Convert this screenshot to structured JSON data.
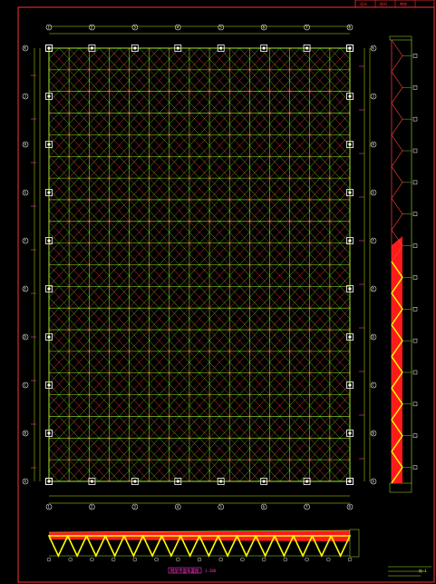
{
  "drawing": {
    "grid_cols": 15,
    "grid_rows": 20,
    "main_axis_labels_x": [
      "1",
      "2",
      "3",
      "4",
      "5",
      "6",
      "7",
      "8"
    ],
    "main_axis_labels_y": [
      "K",
      "J",
      "H",
      "G",
      "F",
      "E",
      "D",
      "C",
      "B",
      "A"
    ],
    "main_caption": "网架平面布置图",
    "main_scale": "1:200",
    "truss_panels_horizontal": 16,
    "truss_panels_vertical": 14,
    "titleblock": {
      "header_cells": [
        "设计",
        "校对",
        "审核"
      ],
      "sheet_no": "结-1"
    }
  },
  "colors": {
    "background": "#000000",
    "frame": "#ff3030",
    "grid_chord": "#9fe82c",
    "grid_diagonal": "#ff4040",
    "grid_web": "#7fd400",
    "dimension": "#b8e600",
    "support": "#ffffff",
    "axis_bubble": "#e8e8e8",
    "truss_fill": "#ff1a1a",
    "truss_web": "#ffff00",
    "magenta": "#ff33cc"
  }
}
